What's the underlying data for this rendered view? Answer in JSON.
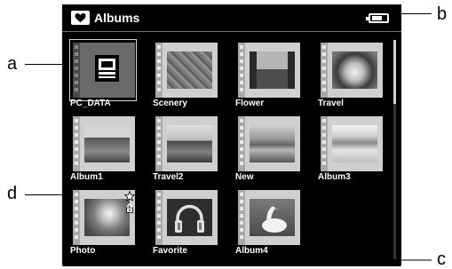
{
  "window": {
    "title": "Albums"
  },
  "status": {
    "battery_level": 0.75
  },
  "callouts": {
    "a": "a",
    "b": "b",
    "c": "c",
    "d": "d"
  },
  "albums": [
    {
      "label": "PC_DATA",
      "icon": "computer-icon",
      "selected": true
    },
    {
      "label": "Scenery",
      "icon": "scenery-thumbnail"
    },
    {
      "label": "Flower",
      "icon": "flower-thumbnail"
    },
    {
      "label": "Travel",
      "icon": "bird-thumbnail"
    },
    {
      "label": "Album1",
      "icon": "building-thumbnail"
    },
    {
      "label": "Travel2",
      "icon": "landscape-thumbnail"
    },
    {
      "label": "New",
      "icon": "shore-thumbnail"
    },
    {
      "label": "Album3",
      "icon": "beach-thumbnail"
    },
    {
      "label": "Photo",
      "icon": "flowers-thumbnail",
      "badges": [
        "star-icon",
        "lock-icon"
      ]
    },
    {
      "label": "Favorite",
      "icon": "headphones-icon"
    },
    {
      "label": "Album4",
      "icon": "swan-thumbnail"
    }
  ]
}
